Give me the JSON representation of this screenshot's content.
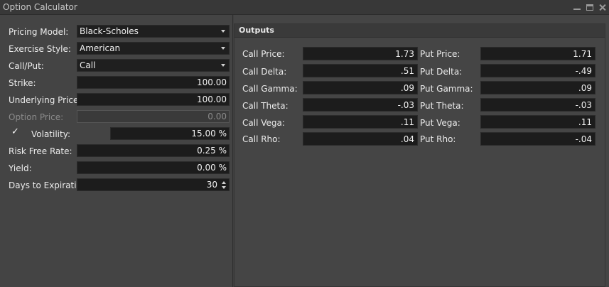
{
  "window": {
    "title": "Option Calculator"
  },
  "inputs": {
    "pricing_model": {
      "label": "Pricing Model:",
      "value": "Black-Scholes"
    },
    "exercise_style": {
      "label": "Exercise Style:",
      "value": "American"
    },
    "call_put": {
      "label": "Call/Put:",
      "value": "Call"
    },
    "strike": {
      "label": "Strike:",
      "value": "100.00"
    },
    "underlying_price": {
      "label": "Underlying Price:",
      "value": "100.00"
    },
    "option_price": {
      "label": "Option Price:",
      "value": "0.00"
    },
    "volatility": {
      "label": "Volatility:",
      "value": "15.00 %",
      "checked": true,
      "check_glyph": "✓"
    },
    "risk_free_rate": {
      "label": "Risk Free Rate:",
      "value": "0.25 %"
    },
    "yield": {
      "label": "Yield:",
      "value": "0.00 %"
    },
    "days_to_expiration": {
      "label": "Days to Expiration:",
      "value": "30"
    }
  },
  "outputs": {
    "title": "Outputs",
    "call": [
      {
        "label": "Call Price:",
        "value": "1.73"
      },
      {
        "label": "Call Delta:",
        "value": ".51"
      },
      {
        "label": "Call Gamma:",
        "value": ".09"
      },
      {
        "label": "Call Theta:",
        "value": "-.03"
      },
      {
        "label": "Call Vega:",
        "value": ".11"
      },
      {
        "label": "Call Rho:",
        "value": ".04"
      }
    ],
    "put": [
      {
        "label": "Put Price:",
        "value": "1.71"
      },
      {
        "label": "Put Delta:",
        "value": "-.49"
      },
      {
        "label": "Put Gamma:",
        "value": ".09"
      },
      {
        "label": "Put Theta:",
        "value": "-.03"
      },
      {
        "label": "Put Vega:",
        "value": ".11"
      },
      {
        "label": "Put Rho:",
        "value": "-.04"
      }
    ]
  }
}
